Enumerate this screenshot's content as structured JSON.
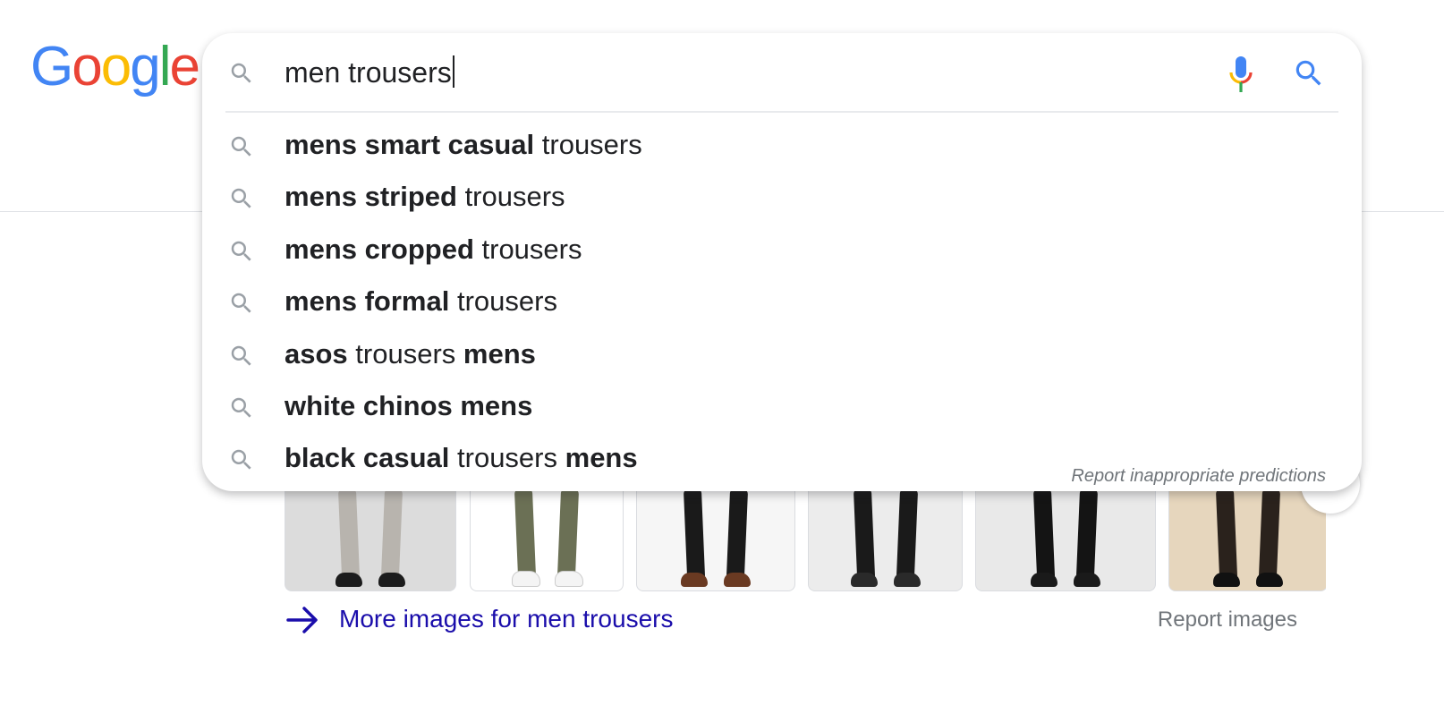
{
  "logo": {
    "letters": [
      {
        "ch": "G",
        "color": "#4285F4"
      },
      {
        "ch": "o",
        "color": "#EA4335"
      },
      {
        "ch": "o",
        "color": "#FBBC05"
      },
      {
        "ch": "g",
        "color": "#4285F4"
      },
      {
        "ch": "l",
        "color": "#34A853"
      },
      {
        "ch": "e",
        "color": "#EA4335"
      }
    ]
  },
  "search": {
    "query": "men trousers",
    "suggestions": [
      {
        "parts": [
          {
            "t": "mens smart casual",
            "b": true
          },
          {
            "t": " trousers",
            "b": false
          }
        ]
      },
      {
        "parts": [
          {
            "t": "mens striped",
            "b": true
          },
          {
            "t": " trousers",
            "b": false
          }
        ]
      },
      {
        "parts": [
          {
            "t": "mens cropped",
            "b": true
          },
          {
            "t": " trousers",
            "b": false
          }
        ]
      },
      {
        "parts": [
          {
            "t": "mens formal",
            "b": true
          },
          {
            "t": " trousers",
            "b": false
          }
        ]
      },
      {
        "parts": [
          {
            "t": "asos",
            "b": true
          },
          {
            "t": " trousers ",
            "b": false
          },
          {
            "t": "mens",
            "b": true
          }
        ]
      },
      {
        "parts": [
          {
            "t": "white chinos mens",
            "b": true
          }
        ]
      },
      {
        "parts": [
          {
            "t": "black casual",
            "b": true
          },
          {
            "t": " trousers ",
            "b": false
          },
          {
            "t": "mens",
            "b": true
          }
        ]
      }
    ],
    "report_predictions": "Report inappropriate predictions"
  },
  "images": {
    "more_link": "More images for men trousers",
    "report": "Report images",
    "thumbs": [
      {
        "bg": "#dcdcdc",
        "pants": "#b8b4ae",
        "shoe": "#1c1c1c"
      },
      {
        "bg": "#ffffff",
        "pants": "#6b7055",
        "shoe": "#f4f4f4"
      },
      {
        "bg": "#f6f6f6",
        "pants": "#1a1a1a",
        "shoe": "#6a3a22"
      },
      {
        "bg": "#ececec",
        "pants": "#1a1a1a",
        "shoe": "#2a2a2a"
      },
      {
        "bg": "#e9e9e9",
        "pants": "#141414",
        "shoe": "#1a1a1a"
      },
      {
        "bg": "#e6d6bd",
        "pants": "#2a221c",
        "shoe": "#111111"
      }
    ]
  },
  "colors": {
    "link": "#1a0dab",
    "muted": "#70757a",
    "icon_gray": "#9aa0a6",
    "search_blue": "#4285F4"
  }
}
